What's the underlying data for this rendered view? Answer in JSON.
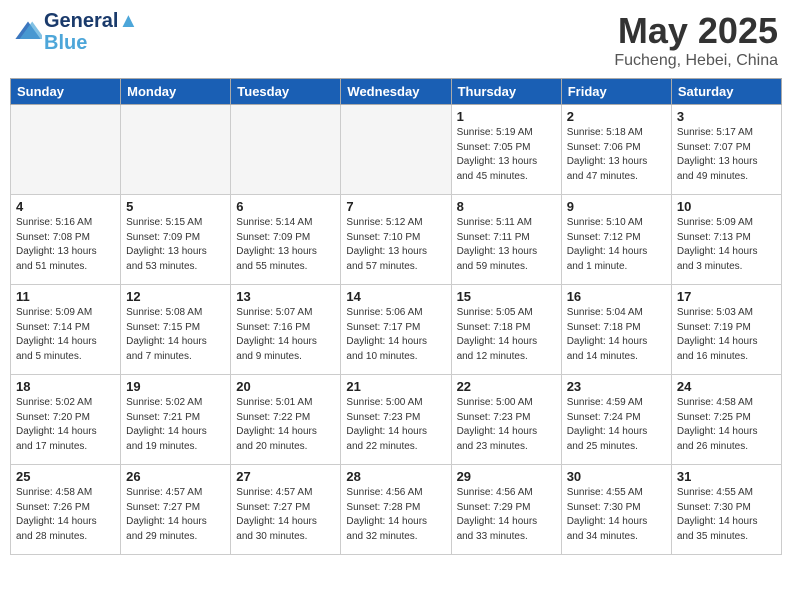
{
  "header": {
    "logo_line1": "General",
    "logo_line2": "Blue",
    "month": "May 2025",
    "location": "Fucheng, Hebei, China"
  },
  "weekdays": [
    "Sunday",
    "Monday",
    "Tuesday",
    "Wednesday",
    "Thursday",
    "Friday",
    "Saturday"
  ],
  "weeks": [
    [
      {
        "day": null,
        "info": null
      },
      {
        "day": null,
        "info": null
      },
      {
        "day": null,
        "info": null
      },
      {
        "day": null,
        "info": null
      },
      {
        "day": "1",
        "info": "Sunrise: 5:19 AM\nSunset: 7:05 PM\nDaylight: 13 hours\nand 45 minutes."
      },
      {
        "day": "2",
        "info": "Sunrise: 5:18 AM\nSunset: 7:06 PM\nDaylight: 13 hours\nand 47 minutes."
      },
      {
        "day": "3",
        "info": "Sunrise: 5:17 AM\nSunset: 7:07 PM\nDaylight: 13 hours\nand 49 minutes."
      }
    ],
    [
      {
        "day": "4",
        "info": "Sunrise: 5:16 AM\nSunset: 7:08 PM\nDaylight: 13 hours\nand 51 minutes."
      },
      {
        "day": "5",
        "info": "Sunrise: 5:15 AM\nSunset: 7:09 PM\nDaylight: 13 hours\nand 53 minutes."
      },
      {
        "day": "6",
        "info": "Sunrise: 5:14 AM\nSunset: 7:09 PM\nDaylight: 13 hours\nand 55 minutes."
      },
      {
        "day": "7",
        "info": "Sunrise: 5:12 AM\nSunset: 7:10 PM\nDaylight: 13 hours\nand 57 minutes."
      },
      {
        "day": "8",
        "info": "Sunrise: 5:11 AM\nSunset: 7:11 PM\nDaylight: 13 hours\nand 59 minutes."
      },
      {
        "day": "9",
        "info": "Sunrise: 5:10 AM\nSunset: 7:12 PM\nDaylight: 14 hours\nand 1 minute."
      },
      {
        "day": "10",
        "info": "Sunrise: 5:09 AM\nSunset: 7:13 PM\nDaylight: 14 hours\nand 3 minutes."
      }
    ],
    [
      {
        "day": "11",
        "info": "Sunrise: 5:09 AM\nSunset: 7:14 PM\nDaylight: 14 hours\nand 5 minutes."
      },
      {
        "day": "12",
        "info": "Sunrise: 5:08 AM\nSunset: 7:15 PM\nDaylight: 14 hours\nand 7 minutes."
      },
      {
        "day": "13",
        "info": "Sunrise: 5:07 AM\nSunset: 7:16 PM\nDaylight: 14 hours\nand 9 minutes."
      },
      {
        "day": "14",
        "info": "Sunrise: 5:06 AM\nSunset: 7:17 PM\nDaylight: 14 hours\nand 10 minutes."
      },
      {
        "day": "15",
        "info": "Sunrise: 5:05 AM\nSunset: 7:18 PM\nDaylight: 14 hours\nand 12 minutes."
      },
      {
        "day": "16",
        "info": "Sunrise: 5:04 AM\nSunset: 7:18 PM\nDaylight: 14 hours\nand 14 minutes."
      },
      {
        "day": "17",
        "info": "Sunrise: 5:03 AM\nSunset: 7:19 PM\nDaylight: 14 hours\nand 16 minutes."
      }
    ],
    [
      {
        "day": "18",
        "info": "Sunrise: 5:02 AM\nSunset: 7:20 PM\nDaylight: 14 hours\nand 17 minutes."
      },
      {
        "day": "19",
        "info": "Sunrise: 5:02 AM\nSunset: 7:21 PM\nDaylight: 14 hours\nand 19 minutes."
      },
      {
        "day": "20",
        "info": "Sunrise: 5:01 AM\nSunset: 7:22 PM\nDaylight: 14 hours\nand 20 minutes."
      },
      {
        "day": "21",
        "info": "Sunrise: 5:00 AM\nSunset: 7:23 PM\nDaylight: 14 hours\nand 22 minutes."
      },
      {
        "day": "22",
        "info": "Sunrise: 5:00 AM\nSunset: 7:23 PM\nDaylight: 14 hours\nand 23 minutes."
      },
      {
        "day": "23",
        "info": "Sunrise: 4:59 AM\nSunset: 7:24 PM\nDaylight: 14 hours\nand 25 minutes."
      },
      {
        "day": "24",
        "info": "Sunrise: 4:58 AM\nSunset: 7:25 PM\nDaylight: 14 hours\nand 26 minutes."
      }
    ],
    [
      {
        "day": "25",
        "info": "Sunrise: 4:58 AM\nSunset: 7:26 PM\nDaylight: 14 hours\nand 28 minutes."
      },
      {
        "day": "26",
        "info": "Sunrise: 4:57 AM\nSunset: 7:27 PM\nDaylight: 14 hours\nand 29 minutes."
      },
      {
        "day": "27",
        "info": "Sunrise: 4:57 AM\nSunset: 7:27 PM\nDaylight: 14 hours\nand 30 minutes."
      },
      {
        "day": "28",
        "info": "Sunrise: 4:56 AM\nSunset: 7:28 PM\nDaylight: 14 hours\nand 32 minutes."
      },
      {
        "day": "29",
        "info": "Sunrise: 4:56 AM\nSunset: 7:29 PM\nDaylight: 14 hours\nand 33 minutes."
      },
      {
        "day": "30",
        "info": "Sunrise: 4:55 AM\nSunset: 7:30 PM\nDaylight: 14 hours\nand 34 minutes."
      },
      {
        "day": "31",
        "info": "Sunrise: 4:55 AM\nSunset: 7:30 PM\nDaylight: 14 hours\nand 35 minutes."
      }
    ]
  ]
}
